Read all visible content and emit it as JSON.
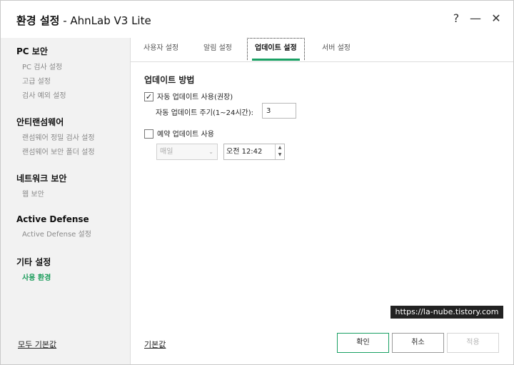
{
  "window": {
    "title_bold": "환경 설정",
    "title_rest": " - AhnLab V3 Lite",
    "help_label": "?",
    "minimize_label": "—",
    "close_label": "✕"
  },
  "sidebar": {
    "groups": [
      {
        "title": "PC 보안",
        "items": [
          "PC 검사 설정",
          "고급 설정",
          "검사 예외 설정"
        ]
      },
      {
        "title": "안티랜섬웨어",
        "items": [
          "랜섬웨어 정밀 검사 설정",
          "랜섬웨어 보안 폴더 설정"
        ]
      },
      {
        "title": "네트워크 보안",
        "items": [
          "웹 보안"
        ]
      },
      {
        "title": "Active Defense",
        "items": [
          "Active Defense 설정"
        ]
      },
      {
        "title": "기타 설정",
        "items": [
          "사용 환경"
        ]
      }
    ],
    "reset_all": "모두 기본값"
  },
  "tabs": [
    "사용자 설정",
    "알림 설정",
    "업데이트 설정",
    "서버 설정"
  ],
  "content": {
    "section_title": "업데이트 방법",
    "auto_update": {
      "label": "자동 업데이트 사용(권장)",
      "checked": true,
      "check_glyph": "✓"
    },
    "interval": {
      "label": "자동 업데이트 주기(1~24시간):",
      "value": "3"
    },
    "scheduled_update": {
      "label": "예약 업데이트 사용",
      "checked": false
    },
    "frequency": {
      "value": "매일",
      "chevron": "⌄"
    },
    "time": {
      "value": "오전 12:42",
      "up": "▲",
      "down": "▼"
    }
  },
  "watermark": "https://la-nube.tistory.com",
  "footer": {
    "reset_label": "기본값",
    "ok_label": "확인",
    "cancel_label": "취소",
    "apply_label": "적용"
  }
}
